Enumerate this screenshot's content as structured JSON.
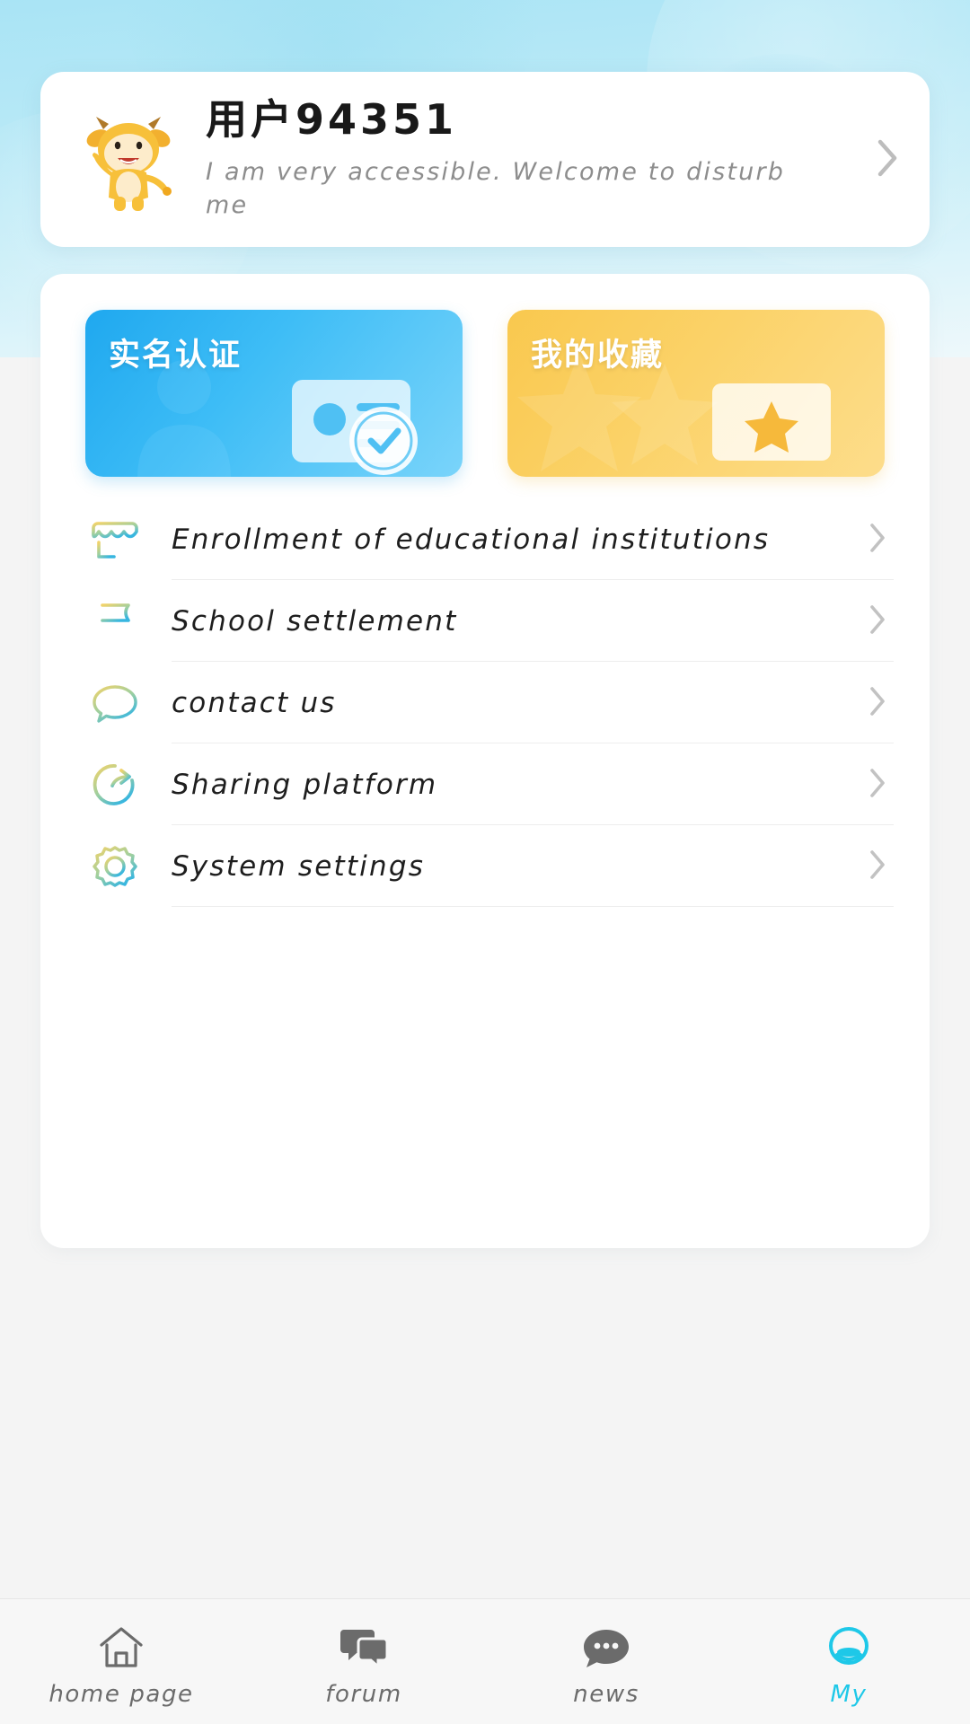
{
  "theme": {
    "sky_top": "#a9e4f5",
    "sky_bottom": "#eef8fb",
    "page_bg": "#f4f4f4",
    "card_bg": "#ffffff",
    "blue_card_start": "#1fa8ef",
    "blue_card_end": "#7ad4fa",
    "yellow_card_start": "#f9c84e",
    "yellow_card_end": "#fddd8b",
    "icon_gradient_start": "#f2d36a",
    "icon_gradient_end": "#37b6e0",
    "active_tab_color": "#1ec8e8",
    "text_primary": "#1e1e1e",
    "text_secondary": "#8d8d8d",
    "divider": "#ededed"
  },
  "profile": {
    "avatar_icon": "cow-mascot-avatar",
    "name": "用户94351",
    "signature": "I am very accessible. Welcome to disturb me",
    "chevron_icon": "chevron-right-icon"
  },
  "feature_cards": [
    {
      "title": "实名认证",
      "color": "blue",
      "art_icon": "id-card-verified-icon"
    },
    {
      "title": "我的收藏",
      "color": "yellow",
      "art_icon": "star-folder-icon"
    }
  ],
  "menu": {
    "items": [
      {
        "label": "Enrollment of educational institutions",
        "icon": "store-add-icon",
        "chevron_icon": "chevron-right-icon"
      },
      {
        "label": "School settlement",
        "icon": "flag-icon",
        "chevron_icon": "chevron-right-icon"
      },
      {
        "label": "contact us",
        "icon": "chat-bubble-icon",
        "chevron_icon": "chevron-right-icon"
      },
      {
        "label": "Sharing platform",
        "icon": "share-circle-icon",
        "chevron_icon": "chevron-right-icon"
      },
      {
        "label": "System settings",
        "icon": "gear-icon",
        "chevron_icon": "chevron-right-icon"
      }
    ]
  },
  "tabbar": {
    "items": [
      {
        "label": "home page",
        "icon": "home-icon",
        "active": false
      },
      {
        "label": "forum",
        "icon": "forum-chat-icon",
        "active": false
      },
      {
        "label": "news",
        "icon": "news-bubble-icon",
        "active": false
      },
      {
        "label": "My",
        "icon": "my-account-icon",
        "active": true
      }
    ]
  }
}
